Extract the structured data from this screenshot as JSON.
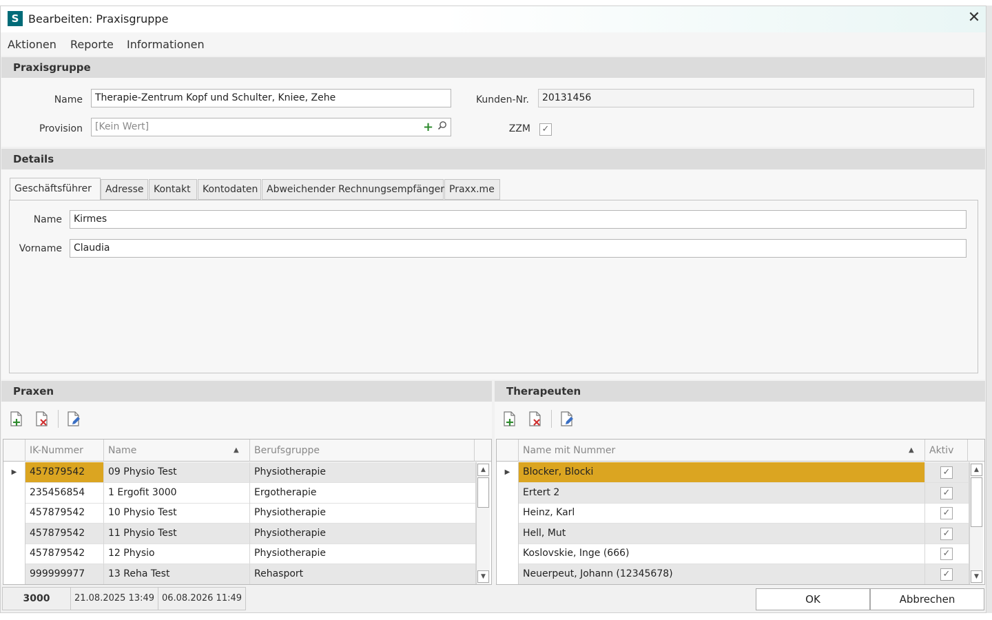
{
  "window": {
    "title": "Bearbeiten: Praxisgruppe",
    "logo_letter": "S",
    "close_glyph": "✕"
  },
  "menu": {
    "items": [
      "Aktionen",
      "Reporte",
      "Informationen"
    ]
  },
  "praxisgruppe": {
    "header": "Praxisgruppe",
    "name_label": "Name",
    "name_value": "Therapie-Zentrum Kopf und Schulter, Kniee, Zehe",
    "kunden_label": "Kunden-Nr.",
    "kunden_value": "20131456",
    "provision_label": "Provision",
    "provision_placeholder": "[Kein Wert]",
    "zzm_label": "ZZM",
    "zzm_checked": true
  },
  "details": {
    "header": "Details",
    "tabs": [
      "Geschäftsführer",
      "Adresse",
      "Kontakt",
      "Kontodaten",
      "Abweichender Rechnungsempfänger",
      "Praxx.me"
    ],
    "active_tab": 0,
    "name_label": "Name",
    "name_value": "Kirmes",
    "vorname_label": "Vorname",
    "vorname_value": "Claudia"
  },
  "praxen": {
    "header": "Praxen",
    "toolbar": [
      "add-document-icon",
      "delete-document-icon",
      "edit-document-icon"
    ],
    "columns": [
      "IK-Nummer",
      "Name",
      "Berufsgruppe"
    ],
    "sort_column": "Name",
    "rows": [
      {
        "ik": "457879542",
        "name": "09 Physio Test",
        "beruf": "Physiotherapie"
      },
      {
        "ik": "235456854",
        "name": "1 Ergofit 3000",
        "beruf": "Ergotherapie"
      },
      {
        "ik": "457879542",
        "name": "10 Physio Test",
        "beruf": "Physiotherapie"
      },
      {
        "ik": "457879542",
        "name": "11 Physio Test",
        "beruf": "Physiotherapie"
      },
      {
        "ik": "457879542",
        "name": "12 Physio",
        "beruf": "Physiotherapie"
      },
      {
        "ik": "999999977",
        "name": "13 Reha Test",
        "beruf": "Rehasport"
      }
    ]
  },
  "therapeuten": {
    "header": "Therapeuten",
    "toolbar": [
      "add-document-icon",
      "delete-document-icon",
      "edit-document-icon"
    ],
    "columns": [
      "Name mit Nummer",
      "Aktiv"
    ],
    "sort_column": "Name mit Nummer",
    "rows": [
      {
        "name": "Blocker, Blocki",
        "aktiv": true
      },
      {
        "name": "Ertert 2",
        "aktiv": true
      },
      {
        "name": "Heinz, Karl",
        "aktiv": true
      },
      {
        "name": "Hell, Mut",
        "aktiv": true
      },
      {
        "name": "Koslovskie, Inge (666)",
        "aktiv": true
      },
      {
        "name": "Neuerpeut, Johann (12345678)",
        "aktiv": true
      }
    ]
  },
  "status": {
    "id": "3000",
    "created": "21.08.2025 13:49",
    "modified": "06.08.2026 11:49"
  },
  "buttons": {
    "ok": "OK",
    "cancel": "Abbrechen"
  },
  "colors": {
    "selection": "#dba521",
    "section_header": "#dcdcdc",
    "logo": "#006b78",
    "add_icon": "#2e8b2e",
    "delete_icon": "#d03030",
    "edit_icon": "#3a6fc4"
  }
}
